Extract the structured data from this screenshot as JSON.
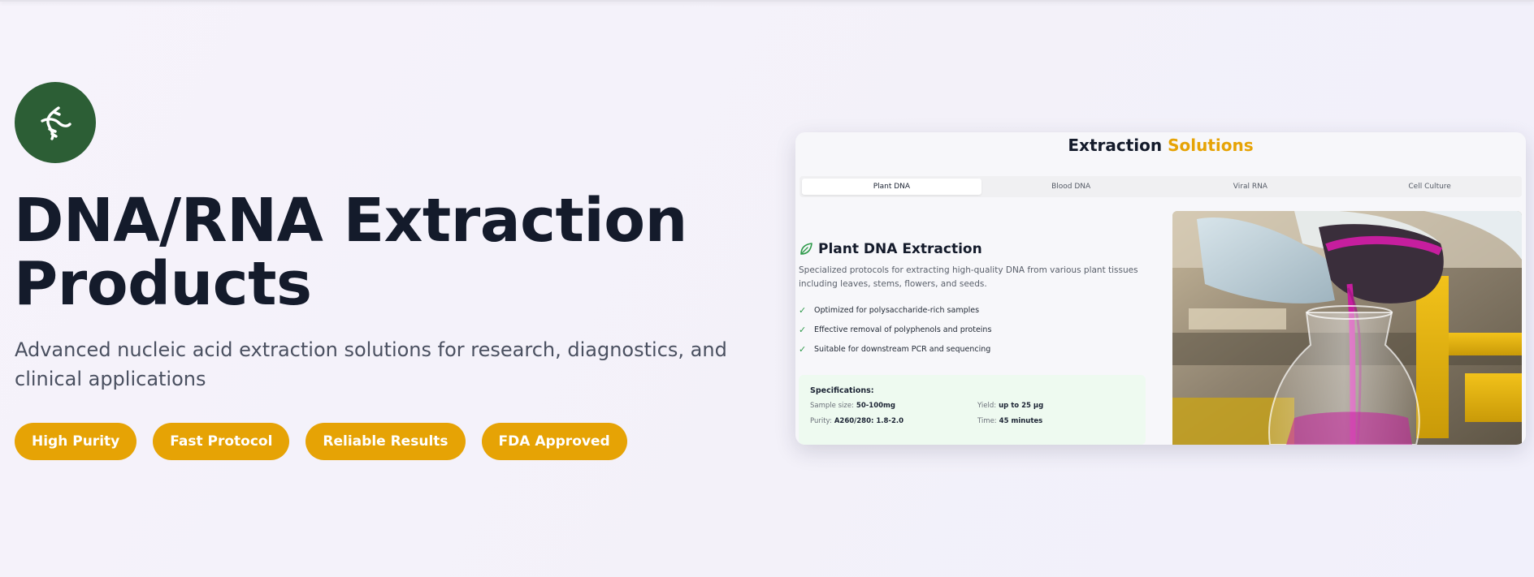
{
  "hero": {
    "icon": "dna-icon",
    "title": "DNA/RNA Extraction Products",
    "subtitle": "Advanced nucleic acid extraction solutions for research, diagnostics, and clinical applications",
    "badges": [
      "High Purity",
      "Fast Protocol",
      "Reliable Results",
      "FDA Approved"
    ]
  },
  "card": {
    "title_main": "Extraction",
    "title_accent": "Solutions",
    "tabs": [
      "Plant DNA",
      "Blood DNA",
      "Viral RNA",
      "Cell Culture"
    ],
    "active_tab": "Plant DNA",
    "panel": {
      "icon": "leaf-icon",
      "heading": "Plant DNA Extraction",
      "description": "Specialized protocols for extracting high-quality DNA from various plant tissues including leaves, stems, flowers, and seeds.",
      "features": [
        "Optimized for polysaccharide-rich samples",
        "Effective removal of polyphenols and proteins",
        "Suitable for downstream PCR and sequencing"
      ],
      "specs_title": "Specifications:",
      "specs": [
        {
          "label": "Sample size:",
          "value": "50-100mg"
        },
        {
          "label": "Yield:",
          "value": "up to 25 μg"
        },
        {
          "label": "Purity:",
          "value": "A260/280: 1.8-2.0"
        },
        {
          "label": "Time:",
          "value": "45 minutes"
        }
      ]
    },
    "image": "lab-pouring-liquid-photo"
  },
  "colors": {
    "accent": "#e6a305",
    "brand_green": "#2c5e35",
    "check_green": "#2e9a4a",
    "title_dark": "#141b2b"
  }
}
